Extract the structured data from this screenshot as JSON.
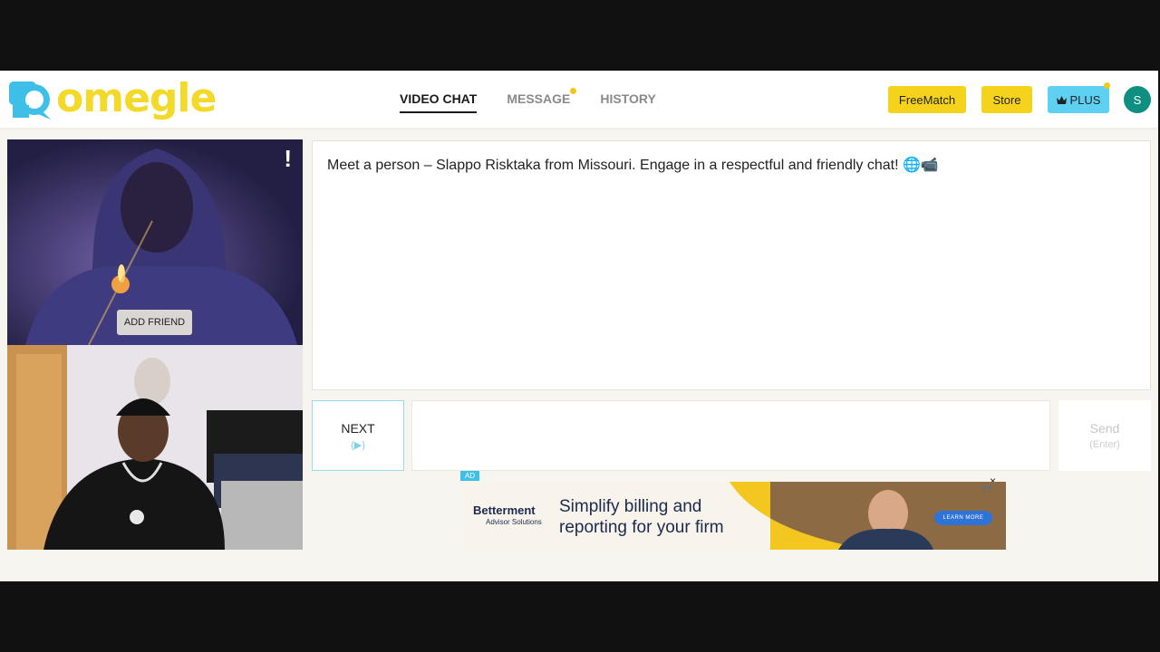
{
  "brand": {
    "logo_text": "omegle"
  },
  "nav": {
    "items": [
      {
        "label": "VIDEO CHAT",
        "active": true
      },
      {
        "label": "MESSAGE",
        "has_dot": true
      },
      {
        "label": "HISTORY"
      }
    ]
  },
  "header_actions": {
    "freematch_label": "FreeMatch",
    "store_label": "Store",
    "plus_label": "PLUS",
    "avatar_initial": "S"
  },
  "stranger_video": {
    "report_label": "!",
    "add_friend_label": "ADD FRIEND"
  },
  "chat": {
    "intro_message": "Meet a person – Slappo Risktaka from Missouri. Engage in a respectful and friendly chat! 🌐📹"
  },
  "controls": {
    "next_label": "NEXT",
    "next_hint": "(▶)",
    "send_label": "Send",
    "send_hint": "(Enter)",
    "message_placeholder": ""
  },
  "ad": {
    "tag": "AD",
    "close_label": "×",
    "brand_name": "Betterment",
    "brand_sub": "Advisor Solutions",
    "headline": "Simplify billing and reporting for your firm",
    "cta": "LEARN MORE",
    "choices_label": "▷×"
  },
  "colors": {
    "brand_yellow": "#f3d92a",
    "brand_blue": "#3ebfe8",
    "button_yellow": "#f5d31c",
    "plus_blue": "#5ed1f3",
    "avatar_teal": "#0f8f82"
  }
}
